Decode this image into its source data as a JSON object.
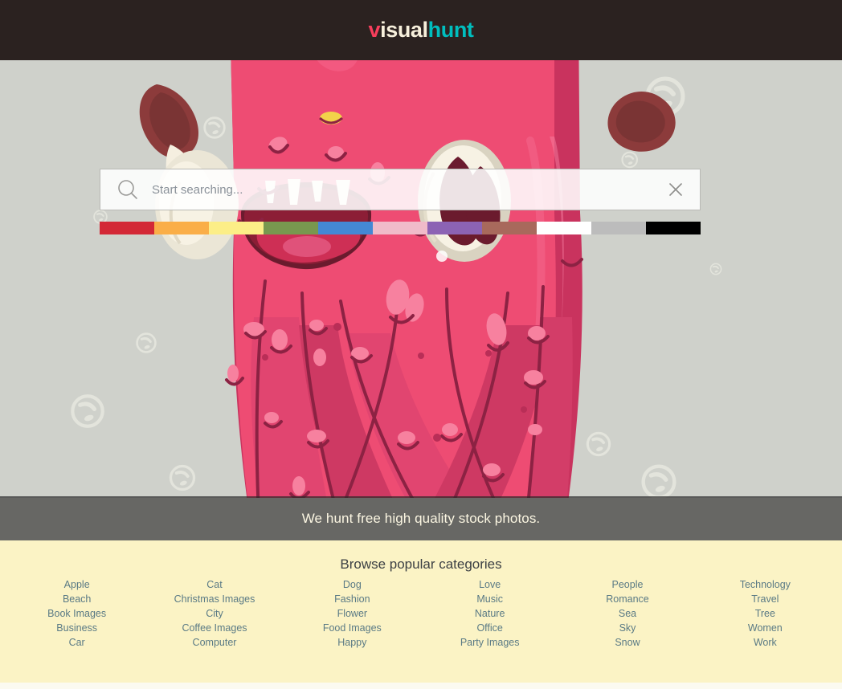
{
  "header": {
    "logo": {
      "part1": "v",
      "part2": "isual",
      "part3": "hunt"
    },
    "logo_colors": {
      "v": "#F73E5C",
      "isual": "#F7F0DC",
      "hunt": "#00BEBE"
    },
    "background": "#2B2220"
  },
  "hero": {
    "background": "#CFD1CB",
    "illustration": "pink-monster-mascot",
    "bubble_color": "#E2E3DB"
  },
  "search": {
    "placeholder": "Start searching...",
    "value": "",
    "search_icon": "search-icon",
    "clear_icon": "close-icon"
  },
  "swatches": [
    {
      "name": "red",
      "hex": "#D32836"
    },
    {
      "name": "orange",
      "hex": "#FAAE48"
    },
    {
      "name": "yellow",
      "hex": "#FCEE87"
    },
    {
      "name": "green",
      "hex": "#78984F"
    },
    {
      "name": "blue",
      "hex": "#4488D4"
    },
    {
      "name": "pink",
      "hex": "#F0BBC9"
    },
    {
      "name": "purple",
      "hex": "#8C63B4"
    },
    {
      "name": "brown",
      "hex": "#A8695C"
    },
    {
      "name": "white",
      "hex": "#FFFFFF"
    },
    {
      "name": "gray",
      "hex": "#BCBCBC"
    },
    {
      "name": "black",
      "hex": "#000000"
    }
  ],
  "tagline": {
    "text": "We hunt free high quality stock photos."
  },
  "categories": {
    "title": "Browse popular categories",
    "columns": [
      {
        "items": [
          "Apple",
          "Beach",
          "Book Images",
          "Business",
          "Car"
        ]
      },
      {
        "items": [
          "Cat",
          "Christmas Images",
          "City",
          "Coffee Images",
          "Computer"
        ]
      },
      {
        "items": [
          "Dog",
          "Fashion",
          "Flower",
          "Food Images",
          "Happy"
        ]
      },
      {
        "items": [
          "Love",
          "Music",
          "Nature",
          "Office",
          "Party Images"
        ]
      },
      {
        "items": [
          "People",
          "Romance",
          "Sea",
          "Sky",
          "Snow"
        ]
      },
      {
        "items": [
          "Technology",
          "Travel",
          "Tree",
          "Women",
          "Work"
        ]
      }
    ],
    "background": "#FBF3C5",
    "link_color": "#5A7A85"
  }
}
